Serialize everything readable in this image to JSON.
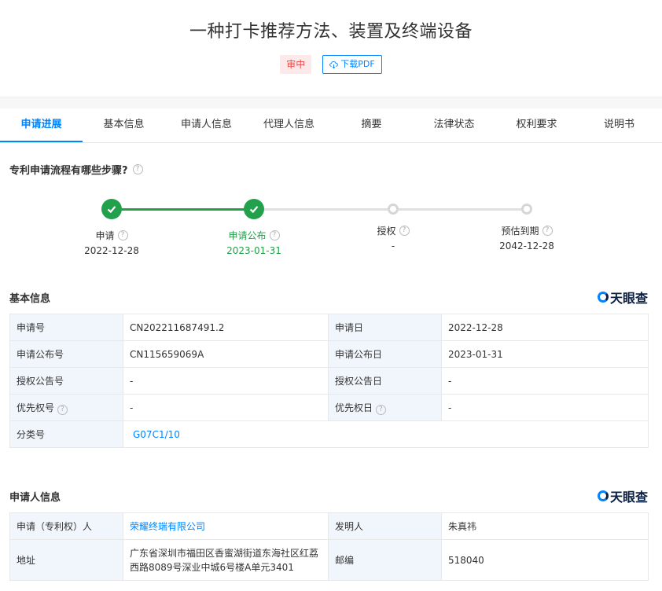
{
  "header": {
    "title": "一种打卡推荐方法、装置及终端设备",
    "status": "审中",
    "pdf_label": "下载PDF"
  },
  "tabs": [
    "申请进展",
    "基本信息",
    "申请人信息",
    "代理人信息",
    "摘要",
    "法律状态",
    "权利要求",
    "说明书"
  ],
  "progress": {
    "title": "专利申请流程有哪些步骤?",
    "steps": [
      {
        "label": "申请",
        "date": "2022-12-28"
      },
      {
        "label": "申请公布",
        "date": "2023-01-31"
      },
      {
        "label": "授权",
        "date": "-"
      },
      {
        "label": "预估到期",
        "date": "2042-12-28"
      }
    ]
  },
  "basic": {
    "title": "基本信息",
    "brand": "天眼查",
    "rows": [
      {
        "k1": "申请号",
        "v1": "CN202211687491.2",
        "k2": "申请日",
        "v2": "2022-12-28"
      },
      {
        "k1": "申请公布号",
        "v1": "CN115659069A",
        "k2": "申请公布日",
        "v2": "2023-01-31"
      },
      {
        "k1": "授权公告号",
        "v1": "-",
        "k2": "授权公告日",
        "v2": "-"
      },
      {
        "k1": "优先权号",
        "v1": "-",
        "k2": "优先权日",
        "v2": "-"
      },
      {
        "k1": "分类号",
        "v1": "G07C1/10"
      }
    ]
  },
  "applicant": {
    "title": "申请人信息",
    "brand": "天眼查",
    "rows": [
      {
        "k1": "申请（专利权）人",
        "v1": "荣耀终端有限公司",
        "k2": "发明人",
        "v2": "朱真祎"
      },
      {
        "k1": "地址",
        "v1": "广东省深圳市福田区香蜜湖街道东海社区红荔西路8089号深业中城6号楼A单元3401",
        "k2": "邮编",
        "v2": "518040"
      }
    ]
  },
  "colors": {
    "accent": "#0084ff",
    "success": "#22a04b",
    "status_bg": "#fde9e9",
    "status_text": "#e24c4c"
  }
}
